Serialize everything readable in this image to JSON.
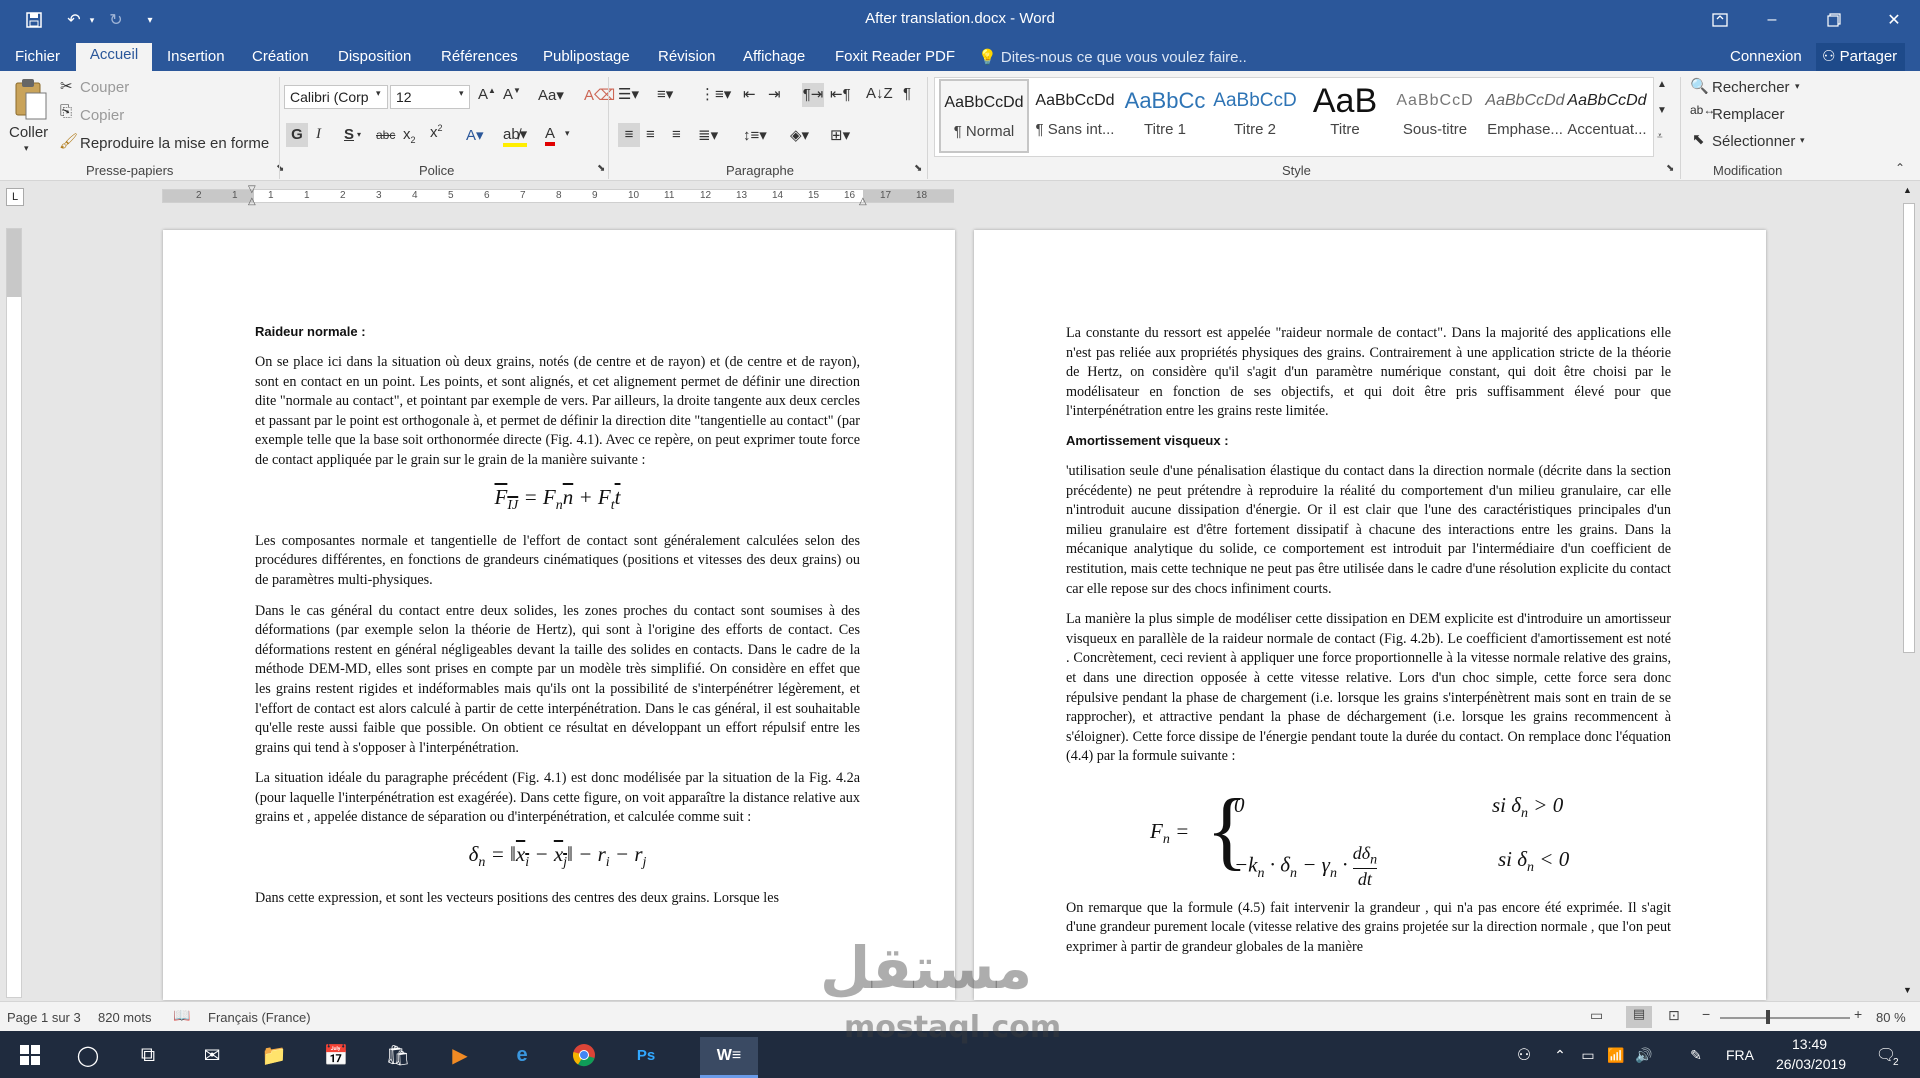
{
  "titlebar": {
    "doc_title": "After translation.docx - Word",
    "bg": "#2b579a"
  },
  "tabs": {
    "file": "Fichier",
    "home": "Accueil",
    "insert": "Insertion",
    "design": "Création",
    "layout": "Disposition",
    "references": "Références",
    "mailings": "Publipostage",
    "review": "Révision",
    "view": "Affichage",
    "foxit": "Foxit Reader PDF",
    "tell_me": "Dites-nous ce que vous voulez faire..",
    "signin": "Connexion",
    "share": "Partager"
  },
  "ribbon": {
    "clipboard": {
      "paste": "Coller",
      "cut": "Couper",
      "copy": "Copier",
      "format_painter": "Reproduire la mise en forme",
      "label": "Presse-papiers"
    },
    "font": {
      "font_name": "Calibri (Corp",
      "font_size": "12",
      "label": "Police"
    },
    "paragraph": {
      "label": "Paragraphe"
    },
    "styles": {
      "label": "Style",
      "items": [
        {
          "sample": "AaBbCcDd",
          "name": "¶ Normal"
        },
        {
          "sample": "AaBbCcDd",
          "name": "¶ Sans int..."
        },
        {
          "sample": "AaBbCc",
          "name": "Titre 1"
        },
        {
          "sample": "AaBbCcD",
          "name": "Titre 2"
        },
        {
          "sample": "AaB",
          "name": "Titre"
        },
        {
          "sample": "AaBbCcD",
          "name": "Sous-titre"
        },
        {
          "sample": "AaBbCcDd",
          "name": "Emphase..."
        },
        {
          "sample": "AaBbCcDd",
          "name": "Accentuat..."
        }
      ]
    },
    "editing": {
      "find": "Rechercher",
      "replace": "Remplacer",
      "select": "Sélectionner",
      "label": "Modification"
    }
  },
  "ruler": {
    "labels": [
      "2",
      "1",
      "1",
      "1",
      "2",
      "3",
      "4",
      "5",
      "6",
      "7",
      "8",
      "9",
      "10",
      "11",
      "12",
      "13",
      "14",
      "15",
      "16",
      "17",
      "18"
    ]
  },
  "page1": {
    "heading": "Raideur normale :",
    "p1": "On se place ici dans la situation où deux grains, notés (de centre et de rayon) et (de centre et de rayon), sont en contact en un point. Les points, et sont alignés, et cet alignement permet de définir une direction dite \"normale au contact\", et pointant par exemple de vers. Par ailleurs, la droite tangente aux deux cercles et passant par le point est orthogonale à, et permet de définir la direction dite \"tangentielle au contact\" (par exemple telle que la base soit orthonormée directe (Fig. 4.1). Avec ce repère, on peut exprimer toute force de contact appliquée par le grain sur le grain de la manière suivante :",
    "p2": "Les composantes normale et tangentielle de l'effort de contact sont généralement calculées selon des procédures différentes, en fonctions de grandeurs cinématiques (positions et vitesses des deux grains) ou de paramètres multi-physiques.",
    "p3": "Dans le cas général du contact entre deux solides, les zones proches du contact sont soumises à des déformations (par exemple selon la théorie de Hertz), qui sont à l'origine des efforts de contact. Ces déformations restent en général négligeables devant la taille des solides en contacts. Dans le cadre de la méthode DEM-MD, elles sont prises en compte par un modèle très simplifié. On considère en effet que les grains restent rigides et indéformables mais qu'ils ont la possibilité de s'interpénétrer légèrement, et l'effort de contact est alors calculé à partir de cette interpénétration. Dans le cas général, il est souhaitable qu'elle reste aussi faible que possible. On obtient ce résultat en développant un effort répulsif entre les grains qui tend à s'opposer à l'interpénétration.",
    "p4": "La situation idéale du paragraphe précédent (Fig. 4.1) est donc modélisée par la situation de la Fig. 4.2a (pour laquelle l'interpénétration est exagérée). Dans cette figure, on voit apparaître la distance relative aux grains et , appelée distance de séparation ou d'interpénétration, et calculée comme suit :",
    "p5": "Dans cette expression, et sont les vecteurs positions des centres des deux grains. Lorsque les"
  },
  "page2": {
    "p1": "La constante du ressort est appelée \"raideur normale de contact\". Dans la majorité des applications elle n'est pas reliée aux propriétés physiques des grains. Contrairement à une application stricte de la théorie de Hertz, on considère qu'il s'agit d'un paramètre numérique constant, qui doit être choisi par le modélisateur en fonction de ses objectifs, et qui doit être pris suffisamment élevé pour que l'interpénétration entre les grains reste limitée.",
    "heading": "Amortissement visqueux :",
    "p2": "'utilisation seule d'une pénalisation élastique du contact dans la direction normale (décrite dans la section précédente) ne peut prétendre à reproduire la réalité du comportement d'un milieu granulaire, car elle n'introduit aucune dissipation d'énergie. Or il est clair que l'une des caractéristiques principales d'un milieu granulaire est d'être fortement dissipatif à chacune des interactions entre les grains. Dans la mécanique analytique du solide, ce comportement est introduit par l'intermédiaire d'un coefficient de restitution, mais cette technique ne peut pas être utilisée dans le cadre d'une résolution explicite du contact car elle repose sur des chocs infiniment courts.",
    "p3": "La manière la plus simple de modéliser cette dissipation en DEM explicite est d'introduire un amortisseur visqueux en parallèle de la raideur normale de contact (Fig. 4.2b). Le coefficient d'amortissement est noté . Concrètement, ceci revient à appliquer une force proportionnelle à la vitesse normale relative des grains, et dans une direction opposée à cette vitesse relative. Lors d'un choc simple, cette force sera donc répulsive pendant la phase de chargement (i.e. lorsque les grains s'interpénètrent mais sont en train de se rapprocher), et attractive pendant la phase de déchargement (i.e. lorsque les grains recommencent à s'éloigner). Cette force dissipe de l'énergie pendant toute la durée du contact. On remplace donc l'équation (4.4) par la formule suivante :",
    "p4": "On remarque que la formule (4.5) fait intervenir la grandeur , qui n'a pas encore été exprimée. Il s'agit d'une grandeur purement locale (vitesse relative des grains projetée sur la direction normale , que l'on peut exprimer à partir de grandeur globales de la manière"
  },
  "statusbar": {
    "page": "Page 1 sur 3",
    "words": "820 mots",
    "language": "Français (France)",
    "zoom": "80 %"
  },
  "taskbar": {
    "lang": "FRA",
    "time": "13:49",
    "date": "26/03/2019",
    "notif_count": "2"
  },
  "watermark": {
    "arabic": "مستقل",
    "latin": "mostaql.com"
  }
}
